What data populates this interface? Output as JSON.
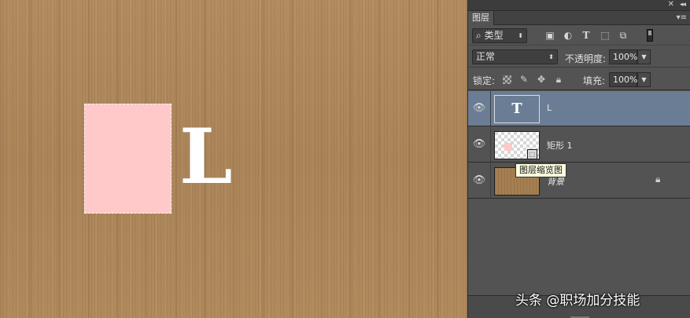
{
  "canvas": {
    "letter": "L",
    "shape_color": "#ffc9c9",
    "background_color": "#b08a5e"
  },
  "panel": {
    "tab_label": "图层",
    "close_icon": "close-icon",
    "collapse_icon": "collapse-icon",
    "menu_icon": "panel-menu-icon",
    "filter": {
      "kind_label": "类型",
      "icons": [
        "image-filter-icon",
        "adjustment-filter-icon",
        "text-filter-icon",
        "shape-filter-icon",
        "smart-object-filter-icon"
      ]
    },
    "blend_mode": "正常",
    "opacity_label": "不透明度:",
    "opacity_value": "100%",
    "lock_label": "锁定:",
    "fill_label": "填充:",
    "fill_value": "100%",
    "layers": [
      {
        "name": "L",
        "type": "text",
        "thumb_label": "T",
        "selected": true
      },
      {
        "name": "矩形 1",
        "type": "shape",
        "selected": false
      },
      {
        "name": "背景",
        "type": "background",
        "locked": true,
        "selected": false
      }
    ],
    "tooltip": "图层缩览图"
  },
  "watermark": "头条 @职场加分技能"
}
